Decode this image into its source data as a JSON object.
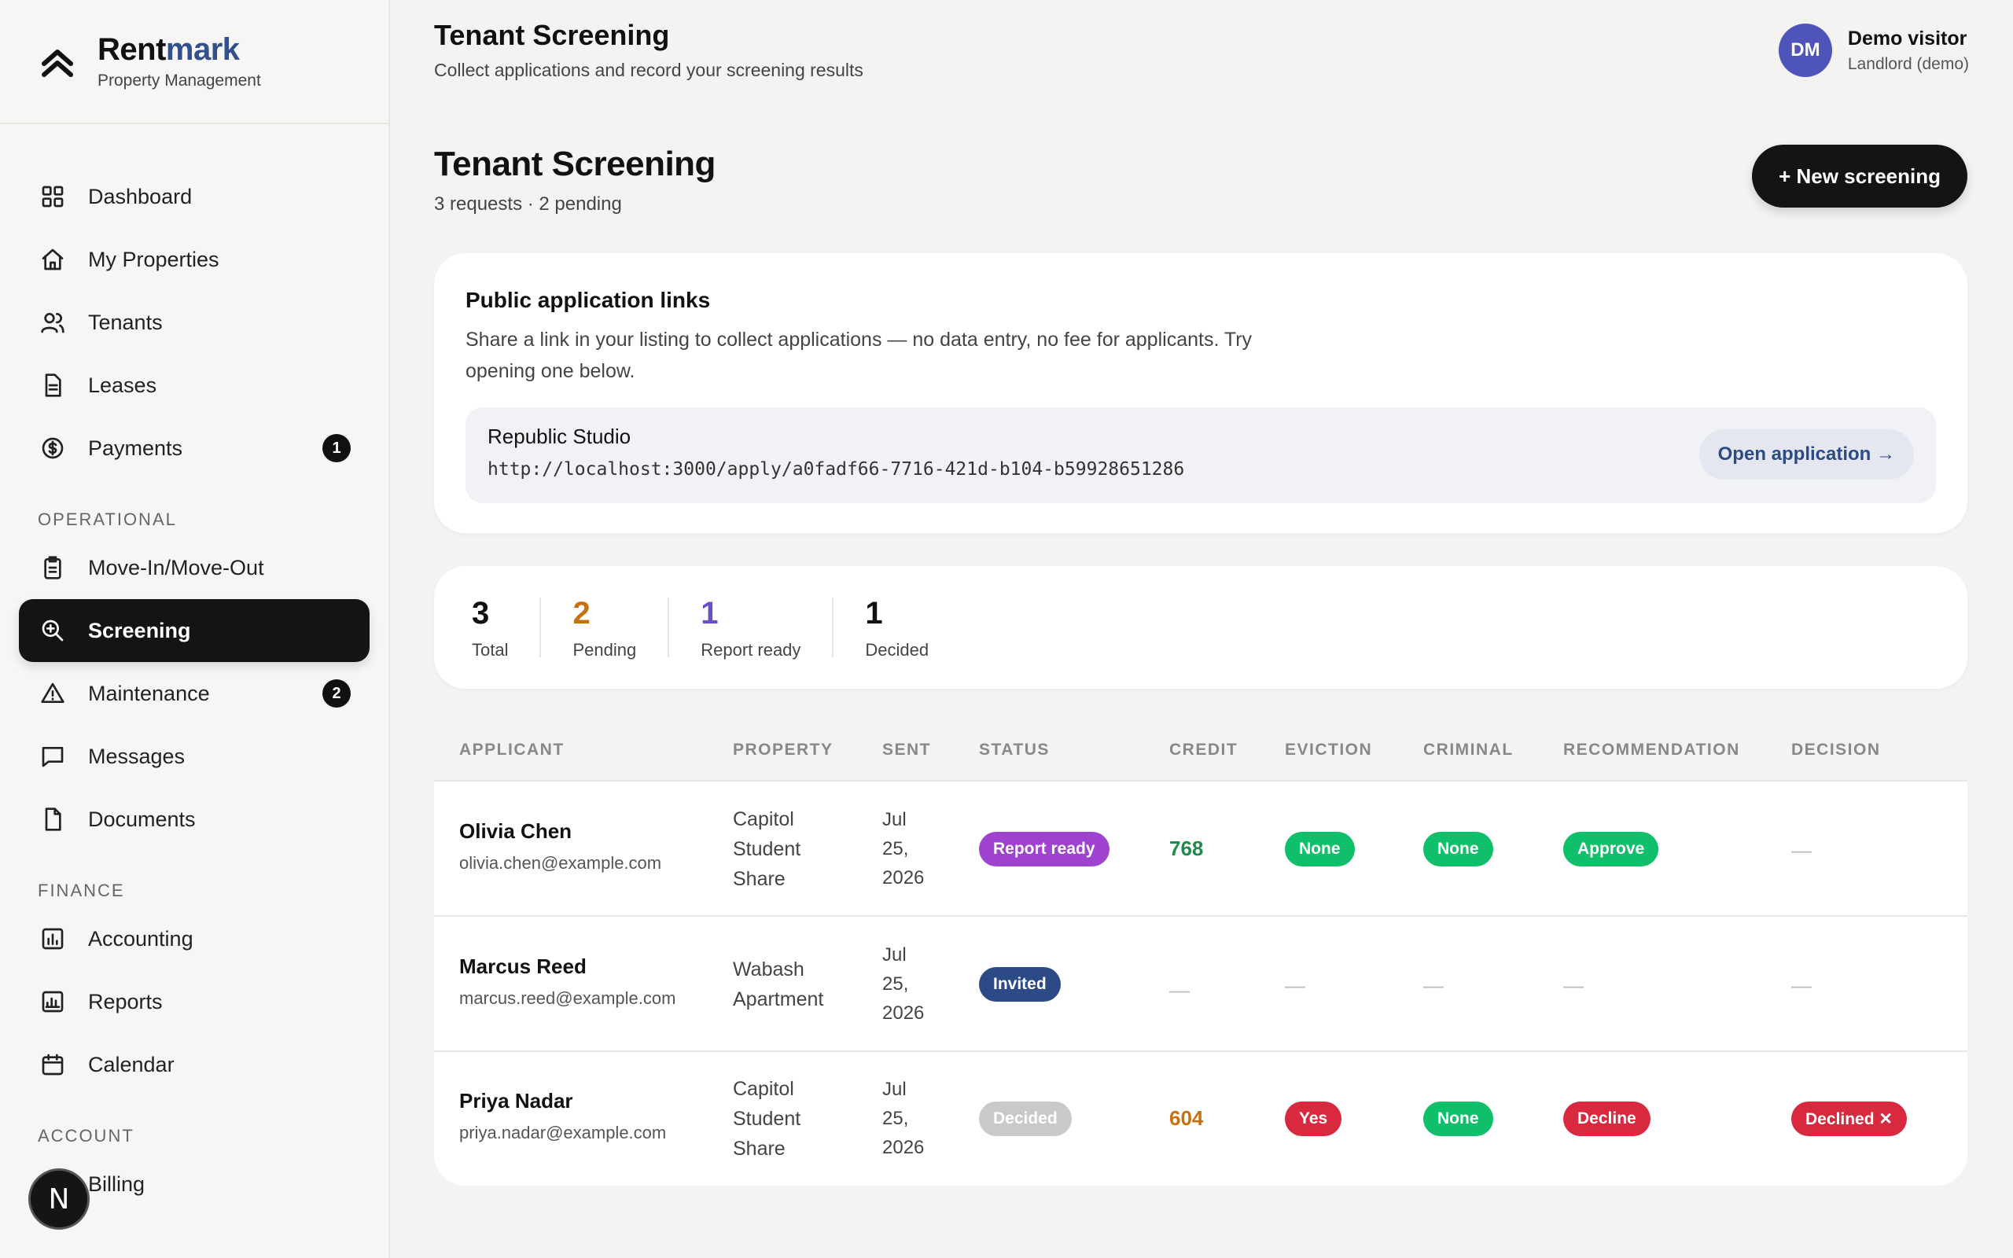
{
  "brand": {
    "name_a": "Rent",
    "name_b": "mark",
    "subtitle": "Property Management"
  },
  "nav": {
    "items": [
      {
        "label": "Dashboard",
        "icon": "grid-icon"
      },
      {
        "label": "My Properties",
        "icon": "home-icon"
      },
      {
        "label": "Tenants",
        "icon": "users-icon"
      },
      {
        "label": "Leases",
        "icon": "file-text-icon"
      },
      {
        "label": "Payments",
        "icon": "dollar-circle-icon",
        "badge": "1"
      }
    ],
    "operational_label": "OPERATIONAL",
    "operational": [
      {
        "label": "Move-In/Move-Out",
        "icon": "clipboard-icon"
      },
      {
        "label": "Screening",
        "icon": "search-plus-icon",
        "active": true
      },
      {
        "label": "Maintenance",
        "icon": "alert-triangle-icon",
        "badge": "2"
      },
      {
        "label": "Messages",
        "icon": "message-square-icon"
      },
      {
        "label": "Documents",
        "icon": "document-icon"
      }
    ],
    "finance_label": "FINANCE",
    "finance": [
      {
        "label": "Accounting",
        "icon": "bar-chart-icon"
      },
      {
        "label": "Reports",
        "icon": "report-chart-icon"
      },
      {
        "label": "Calendar",
        "icon": "calendar-icon"
      }
    ],
    "account_label": "ACCOUNT",
    "account": [
      {
        "label": "Billing",
        "icon": "credit-card-icon"
      }
    ]
  },
  "next_badge": "N",
  "header": {
    "title": "Tenant Screening",
    "subtitle": "Collect applications and record your screening results",
    "user_initials": "DM",
    "user_name": "Demo visitor",
    "user_role": "Landlord (demo)"
  },
  "page": {
    "title": "Tenant Screening",
    "subtitle": "3 requests · 2 pending",
    "new_button": "+ New screening"
  },
  "links": {
    "title": "Public application links",
    "description": "Share a link in your listing to collect applications — no data entry, no fee for applicants. Try opening one below.",
    "items": [
      {
        "name": "Republic Studio",
        "url": "http://localhost:3000/apply/a0fadf66-7716-421d-b104-b59928651286",
        "button": "Open application →"
      }
    ]
  },
  "stats": [
    {
      "value": "3",
      "label": "Total",
      "color": "#111111"
    },
    {
      "value": "2",
      "label": "Pending",
      "color": "#c8700e"
    },
    {
      "value": "1",
      "label": "Report ready",
      "color": "#6b4fc9"
    },
    {
      "value": "1",
      "label": "Decided",
      "color": "#111111"
    }
  ],
  "table": {
    "headers": [
      "APPLICANT",
      "PROPERTY",
      "SENT",
      "STATUS",
      "CREDIT",
      "EVICTION",
      "CRIMINAL",
      "RECOMMENDATION",
      "DECISION"
    ],
    "rows": [
      {
        "name": "Olivia Chen",
        "email": "olivia.chen@example.com",
        "property": [
          "Capitol",
          "Student",
          "Share"
        ],
        "sent": [
          "Jul",
          "25,",
          "2026"
        ],
        "status": {
          "label": "Report ready",
          "color": "#a042d0"
        },
        "credit": {
          "value": "768",
          "color": "#1f8a4c"
        },
        "eviction": {
          "label": "None",
          "color": "#0fbf6a"
        },
        "criminal": {
          "label": "None",
          "color": "#0fbf6a"
        },
        "recommendation": {
          "label": "Approve",
          "color": "#0fbf6a"
        },
        "decision": null
      },
      {
        "name": "Marcus Reed",
        "email": "marcus.reed@example.com",
        "property": [
          "Wabash",
          "Apartment"
        ],
        "sent": [
          "Jul",
          "25,",
          "2026"
        ],
        "status": {
          "label": "Invited",
          "color": "#2c4a86"
        },
        "credit": null,
        "eviction": null,
        "criminal": null,
        "recommendation": null,
        "decision": null
      },
      {
        "name": "Priya Nadar",
        "email": "priya.nadar@example.com",
        "property": [
          "Capitol",
          "Student",
          "Share"
        ],
        "sent": [
          "Jul",
          "25,",
          "2026"
        ],
        "status": {
          "label": "Decided",
          "color": "#c9c9c9"
        },
        "credit": {
          "value": "604",
          "color": "#c8700e"
        },
        "eviction": {
          "label": "Yes",
          "color": "#d9293f"
        },
        "criminal": {
          "label": "None",
          "color": "#0fbf6a"
        },
        "recommendation": {
          "label": "Decline",
          "color": "#d9293f"
        },
        "decision": {
          "label": "Declined ✕",
          "color": "#d9293f"
        }
      }
    ],
    "empty": "—"
  }
}
